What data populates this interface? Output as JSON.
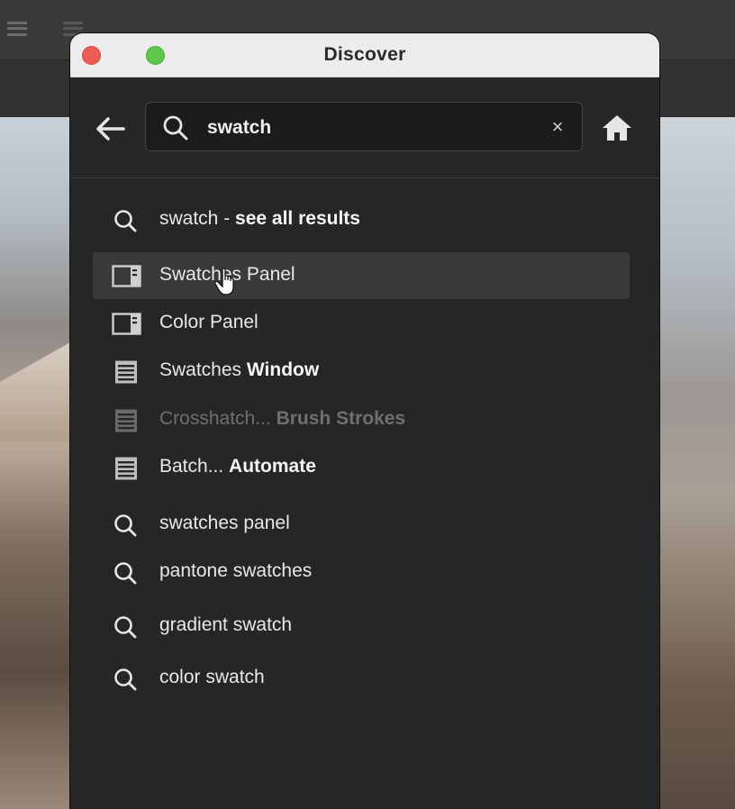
{
  "window": {
    "title": "Discover"
  },
  "search": {
    "value": "swatch",
    "clear_label": "×"
  },
  "results": [
    {
      "icon": "search-icon",
      "prefix": "swatch - ",
      "bold": "see all results"
    },
    {
      "icon": "panel-icon",
      "prefix": "Swatches Panel",
      "bold": ""
    },
    {
      "icon": "panel-icon",
      "prefix": "Color Panel",
      "bold": ""
    },
    {
      "icon": "menu-icon",
      "prefix": "Swatches ",
      "bold": "Window"
    },
    {
      "icon": "menu-icon",
      "prefix": "Crosshatch... ",
      "bold": "Brush Strokes"
    },
    {
      "icon": "menu-icon",
      "prefix": "Batch... ",
      "bold": "Automate"
    },
    {
      "icon": "search-icon",
      "prefix": "swatches panel",
      "bold": ""
    },
    {
      "icon": "search-icon",
      "prefix": "pantone swatches",
      "bold": ""
    },
    {
      "icon": "search-icon",
      "prefix": "gradient swatch",
      "bold": ""
    },
    {
      "icon": "search-icon",
      "prefix": "color swatch",
      "bold": ""
    }
  ],
  "colors": {
    "panel_bg": "#262626",
    "row_highlight": "#3a3a3a",
    "disabled_text": "#6f6f6f"
  }
}
